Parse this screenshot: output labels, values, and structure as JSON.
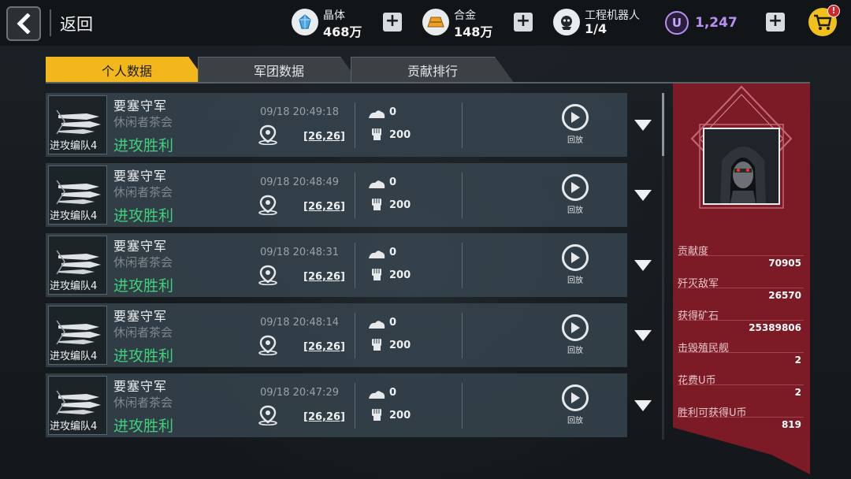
{
  "topbar": {
    "back_label": "返回",
    "resources": [
      {
        "name": "晶体",
        "value": "468万",
        "icon": "crystal-icon",
        "color": "#5bb7f0"
      },
      {
        "name": "合金",
        "value": "148万",
        "icon": "alloy-icon",
        "color": "#f0a020"
      },
      {
        "name": "工程机器人",
        "value": "1/4",
        "icon": "robot-icon",
        "color": "#e6e9ec"
      }
    ],
    "ucoin": {
      "icon_letter": "U",
      "value": "1,247",
      "color": "#b98ff5"
    },
    "cart_badge": "!"
  },
  "tabs": [
    {
      "label": "个人数据",
      "active": true
    },
    {
      "label": "军团数据",
      "active": false
    },
    {
      "label": "贡献排行",
      "active": false
    }
  ],
  "records": [
    {
      "squad": "进攻编队4",
      "title": "要塞守军",
      "guild": "休闲者茶会",
      "result": "进攻胜利",
      "time": "09/18 20:49:18",
      "coord": "[26,26]",
      "stat1": "0",
      "stat2": "200",
      "replay": "回放"
    },
    {
      "squad": "进攻编队4",
      "title": "要塞守军",
      "guild": "休闲者茶会",
      "result": "进攻胜利",
      "time": "09/18 20:48:49",
      "coord": "[26,26]",
      "stat1": "0",
      "stat2": "200",
      "replay": "回放"
    },
    {
      "squad": "进攻编队4",
      "title": "要塞守军",
      "guild": "休闲者茶会",
      "result": "进攻胜利",
      "time": "09/18 20:48:31",
      "coord": "[26,26]",
      "stat1": "0",
      "stat2": "200",
      "replay": "回放"
    },
    {
      "squad": "进攻编队4",
      "title": "要塞守军",
      "guild": "休闲者茶会",
      "result": "进攻胜利",
      "time": "09/18 20:48:14",
      "coord": "[26,26]",
      "stat1": "0",
      "stat2": "200",
      "replay": "回放"
    },
    {
      "squad": "进攻编队4",
      "title": "要塞守军",
      "guild": "休闲者茶会",
      "result": "进攻胜利",
      "time": "09/18 20:47:29",
      "coord": "[26,26]",
      "stat1": "0",
      "stat2": "200",
      "replay": "回放"
    }
  ],
  "stats": [
    {
      "label": "贡献度",
      "value": "70905"
    },
    {
      "label": "歼灭敌军",
      "value": "26570"
    },
    {
      "label": "获得矿石",
      "value": "25389806"
    },
    {
      "label": "击毁殖民舰",
      "value": "2"
    },
    {
      "label": "花费U币",
      "value": "2"
    },
    {
      "label": "胜利可获得U币",
      "value": "819"
    }
  ]
}
